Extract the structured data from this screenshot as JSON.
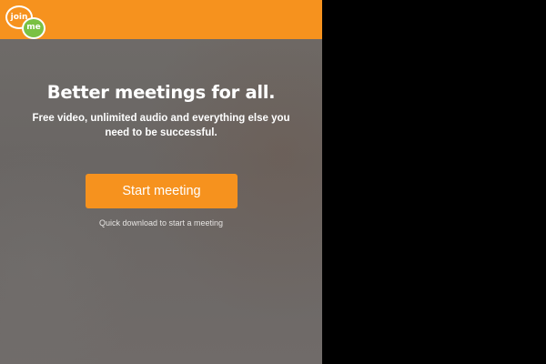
{
  "header": {
    "logo": {
      "word_top": "join",
      "word_bottom": "me",
      "icon": "join-me-logo-icon"
    }
  },
  "hero": {
    "title": "Better meetings for all.",
    "subtitle": "Free video, unlimited audio and everything else you need to be successful.",
    "start_button_label": "Start meeting",
    "download_note": "Quick download to start a meeting"
  },
  "colors": {
    "brand_orange": "#f6921e",
    "brand_green": "#7ac143",
    "background_gray": "#6d6a67",
    "outside_area": "#000000"
  }
}
